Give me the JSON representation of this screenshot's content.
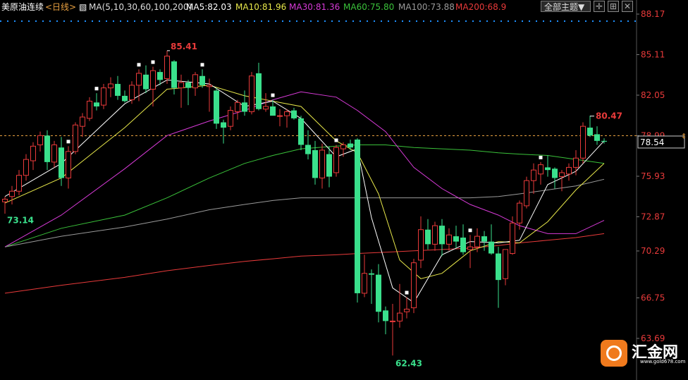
{
  "header": {
    "symbol": "美原油连续",
    "period": "<日线>",
    "ma_params": "MA(5,10,30,60,100,200)",
    "ma5": "MA5:82.03",
    "ma10": "MA10:81.96",
    "ma30": "MA30:81.36",
    "ma60": "MA60:75.80",
    "ma100": "MA100:73.88",
    "ma200": "MA200:68.9",
    "theme_button": "全部主题▼"
  },
  "colors": {
    "up": "#e83a3a",
    "down": "#3ae08c",
    "ma5": "#ffffff",
    "ma10": "#e8e84a",
    "ma30": "#d63ad6",
    "ma60": "#3ac23a",
    "ma100": "#9a9a9a",
    "ma200": "#e83a3a",
    "axis_text": "#e83a3a",
    "current_price_line": "#e8a040"
  },
  "chart_data": {
    "type": "candlestick",
    "y_axis_ticks": [
      "88.17",
      "85.11",
      "82.05",
      "78.99",
      "75.93",
      "72.87",
      "70.29",
      "66.75",
      "63.69"
    ],
    "y_axis_values": [
      88.17,
      85.11,
      82.05,
      78.99,
      75.93,
      72.87,
      70.29,
      66.75,
      63.69
    ],
    "current_price": "78.54",
    "annotations": {
      "high_label": "85.41",
      "low_label": "62.43",
      "start_low_label": "73.14",
      "recent_high_label": "80.47"
    },
    "candles": [
      [
        74.0,
        74.4,
        73.1,
        74.2
      ],
      [
        74.4,
        75.2,
        73.8,
        74.8
      ],
      [
        74.8,
        76.4,
        74.5,
        76.0
      ],
      [
        76.0,
        77.6,
        75.6,
        77.2
      ],
      [
        77.1,
        78.5,
        76.4,
        78.2
      ],
      [
        78.3,
        79.3,
        77.8,
        79.0
      ],
      [
        79.0,
        79.4,
        76.4,
        77.0
      ],
      [
        77.0,
        78.6,
        76.6,
        78.3
      ],
      [
        78.1,
        78.9,
        75.2,
        75.8
      ],
      [
        75.8,
        78.2,
        75.0,
        77.8
      ],
      [
        77.8,
        80.0,
        77.6,
        79.8
      ],
      [
        79.7,
        80.7,
        78.9,
        80.4
      ],
      [
        80.3,
        81.9,
        80.1,
        81.6
      ],
      [
        81.5,
        82.2,
        80.9,
        81.2
      ],
      [
        81.3,
        82.9,
        81.0,
        82.6
      ],
      [
        82.6,
        83.4,
        81.9,
        82.9
      ],
      [
        82.9,
        83.5,
        81.7,
        82.0
      ],
      [
        82.0,
        82.4,
        81.5,
        81.6
      ],
      [
        81.7,
        83.1,
        81.4,
        82.8
      ],
      [
        82.8,
        84.0,
        81.6,
        83.7
      ],
      [
        83.6,
        84.3,
        82.2,
        82.5
      ],
      [
        82.5,
        84.2,
        81.2,
        83.9
      ],
      [
        83.8,
        84.0,
        82.8,
        83.2
      ],
      [
        83.3,
        85.4,
        82.9,
        85.0
      ],
      [
        84.6,
        84.7,
        82.1,
        82.6
      ],
      [
        82.6,
        83.6,
        81.1,
        83.0
      ],
      [
        83.0,
        83.2,
        81.3,
        82.6
      ],
      [
        82.6,
        83.8,
        82.0,
        83.6
      ],
      [
        83.5,
        84.0,
        82.6,
        82.8
      ],
      [
        82.7,
        83.3,
        80.8,
        82.8
      ],
      [
        82.4,
        82.6,
        79.5,
        79.9
      ],
      [
        80.0,
        80.2,
        78.4,
        79.6
      ],
      [
        79.7,
        81.2,
        79.4,
        80.9
      ],
      [
        80.8,
        81.7,
        80.2,
        81.5
      ],
      [
        81.5,
        82.4,
        80.5,
        80.8
      ],
      [
        80.8,
        83.8,
        80.6,
        83.5
      ],
      [
        83.7,
        84.5,
        80.9,
        81.0
      ],
      [
        81.0,
        82.2,
        80.8,
        81.2
      ],
      [
        81.2,
        81.7,
        80.6,
        80.5
      ],
      [
        80.5,
        81.0,
        79.7,
        80.5
      ],
      [
        80.5,
        81.0,
        79.6,
        80.8
      ],
      [
        80.9,
        81.1,
        80.2,
        80.3
      ],
      [
        80.3,
        80.5,
        77.9,
        78.3
      ],
      [
        78.3,
        79.4,
        77.2,
        77.6
      ],
      [
        77.9,
        78.6,
        75.3,
        75.8
      ],
      [
        75.8,
        78.4,
        75.0,
        77.9
      ],
      [
        77.6,
        78.2,
        75.1,
        75.9
      ],
      [
        76.2,
        78.3,
        75.9,
        78.1
      ],
      [
        78.0,
        78.5,
        77.4,
        78.3
      ],
      [
        78.4,
        78.7,
        77.9,
        78.1
      ],
      [
        78.7,
        78.8,
        66.4,
        67.1
      ],
      [
        67.1,
        70.0,
        66.8,
        68.6
      ],
      [
        68.6,
        68.9,
        66.3,
        68.5
      ],
      [
        68.5,
        69.3,
        64.9,
        65.7
      ],
      [
        65.8,
        66.1,
        64.0,
        65.0
      ],
      [
        65.0,
        66.3,
        62.4,
        65.0
      ],
      [
        65.0,
        67.8,
        64.5,
        65.6
      ],
      [
        65.7,
        66.8,
        65.2,
        65.9
      ],
      [
        66.0,
        69.7,
        65.6,
        69.4
      ],
      [
        69.6,
        72.9,
        69.0,
        71.9
      ],
      [
        71.9,
        72.7,
        70.4,
        70.8
      ],
      [
        70.8,
        72.5,
        70.3,
        72.2
      ],
      [
        72.2,
        72.7,
        69.9,
        70.8
      ],
      [
        70.8,
        72.0,
        70.3,
        71.5
      ],
      [
        71.4,
        72.2,
        70.5,
        71.0
      ],
      [
        71.3,
        72.3,
        70.0,
        70.2
      ],
      [
        70.4,
        71.5,
        69.0,
        70.6
      ],
      [
        70.6,
        72.0,
        70.2,
        71.4
      ],
      [
        71.4,
        71.8,
        70.3,
        71.0
      ],
      [
        71.0,
        72.3,
        70.0,
        70.1
      ],
      [
        70.1,
        70.6,
        66.0,
        68.1
      ],
      [
        68.2,
        69.9,
        67.7,
        70.4
      ],
      [
        70.1,
        72.9,
        70.0,
        72.4
      ],
      [
        72.4,
        74.1,
        71.9,
        73.9
      ],
      [
        73.7,
        75.9,
        73.5,
        75.6
      ],
      [
        75.6,
        76.9,
        74.6,
        76.4
      ],
      [
        76.1,
        77.0,
        75.3,
        76.8
      ],
      [
        76.6,
        77.5,
        75.9,
        76.4
      ],
      [
        76.5,
        76.6,
        75.0,
        75.8
      ],
      [
        75.9,
        76.4,
        74.8,
        76.2
      ],
      [
        76.1,
        76.9,
        75.6,
        76.6
      ],
      [
        76.6,
        77.9,
        76.0,
        77.3
      ],
      [
        77.3,
        80.0,
        76.9,
        79.7
      ],
      [
        79.6,
        80.5,
        78.9,
        79.0
      ],
      [
        79.1,
        79.7,
        78.3,
        78.6
      ],
      [
        78.6,
        78.8,
        78.4,
        78.54
      ]
    ],
    "ma5": [
      [
        0,
        74.4
      ],
      [
        8,
        76.9
      ],
      [
        17,
        81.4
      ],
      [
        23,
        83.2
      ],
      [
        29,
        82.9
      ],
      [
        34,
        81.2
      ],
      [
        38,
        81.6
      ],
      [
        42,
        80.3
      ],
      [
        47,
        77.4
      ],
      [
        50,
        78.0
      ],
      [
        52,
        72.8
      ],
      [
        55,
        67.5
      ],
      [
        58,
        66.4
      ],
      [
        62,
        70.0
      ],
      [
        66,
        71.0
      ],
      [
        70,
        70.9
      ],
      [
        73,
        71.1
      ],
      [
        77,
        75.3
      ],
      [
        81,
        76.3
      ],
      [
        85,
        78.6
      ]
    ],
    "ma10": [
      [
        0,
        73.9
      ],
      [
        8,
        75.8
      ],
      [
        17,
        79.6
      ],
      [
        23,
        82.5
      ],
      [
        29,
        82.8
      ],
      [
        34,
        82.0
      ],
      [
        38,
        81.6
      ],
      [
        42,
        81.2
      ],
      [
        47,
        78.6
      ],
      [
        50,
        77.7
      ],
      [
        53,
        74.6
      ],
      [
        56,
        69.6
      ],
      [
        59,
        68.2
      ],
      [
        62,
        68.6
      ],
      [
        66,
        70.3
      ],
      [
        70,
        71.0
      ],
      [
        73,
        70.9
      ],
      [
        77,
        72.5
      ],
      [
        81,
        74.9
      ],
      [
        85,
        76.9
      ]
    ],
    "ma30": [
      [
        0,
        70.6
      ],
      [
        8,
        73.0
      ],
      [
        17,
        76.5
      ],
      [
        23,
        79.0
      ],
      [
        29,
        80.1
      ],
      [
        34,
        80.9
      ],
      [
        38,
        81.7
      ],
      [
        42,
        82.3
      ],
      [
        47,
        81.9
      ],
      [
        50,
        80.9
      ],
      [
        54,
        79.3
      ],
      [
        58,
        76.6
      ],
      [
        62,
        75.0
      ],
      [
        66,
        73.8
      ],
      [
        70,
        73.0
      ],
      [
        73,
        72.2
      ],
      [
        77,
        71.6
      ],
      [
        81,
        71.6
      ],
      [
        85,
        72.6
      ]
    ],
    "ma60": [
      [
        0,
        70.6
      ],
      [
        8,
        72.0
      ],
      [
        17,
        73.0
      ],
      [
        23,
        74.3
      ],
      [
        29,
        75.8
      ],
      [
        34,
        76.9
      ],
      [
        38,
        77.5
      ],
      [
        42,
        78.0
      ],
      [
        47,
        78.2
      ],
      [
        50,
        78.3
      ],
      [
        54,
        78.3
      ],
      [
        58,
        78.1
      ],
      [
        62,
        78.0
      ],
      [
        66,
        77.9
      ],
      [
        70,
        77.7
      ],
      [
        73,
        77.6
      ],
      [
        77,
        77.5
      ],
      [
        81,
        77.2
      ],
      [
        85,
        76.9
      ]
    ],
    "ma100": [
      [
        0,
        70.6
      ],
      [
        8,
        71.4
      ],
      [
        17,
        72.1
      ],
      [
        23,
        72.7
      ],
      [
        29,
        73.4
      ],
      [
        34,
        73.8
      ],
      [
        38,
        74.1
      ],
      [
        42,
        74.3
      ],
      [
        47,
        74.3
      ],
      [
        50,
        74.3
      ],
      [
        54,
        74.3
      ],
      [
        58,
        74.3
      ],
      [
        62,
        74.3
      ],
      [
        66,
        74.3
      ],
      [
        70,
        74.4
      ],
      [
        73,
        74.6
      ],
      [
        77,
        74.9
      ],
      [
        81,
        75.2
      ],
      [
        85,
        75.7
      ]
    ],
    "ma200": [
      [
        0,
        67.1
      ],
      [
        8,
        67.7
      ],
      [
        17,
        68.3
      ],
      [
        23,
        68.8
      ],
      [
        29,
        69.2
      ],
      [
        34,
        69.5
      ],
      [
        38,
        69.7
      ],
      [
        42,
        69.9
      ],
      [
        47,
        70.0
      ],
      [
        50,
        70.1
      ],
      [
        54,
        70.2
      ],
      [
        58,
        70.3
      ],
      [
        62,
        70.4
      ],
      [
        66,
        70.5
      ],
      [
        70,
        70.7
      ],
      [
        73,
        70.9
      ],
      [
        77,
        71.1
      ],
      [
        81,
        71.3
      ],
      [
        85,
        71.6
      ]
    ]
  },
  "watermark": {
    "name": "汇金网",
    "url": "www.gold678.com"
  }
}
